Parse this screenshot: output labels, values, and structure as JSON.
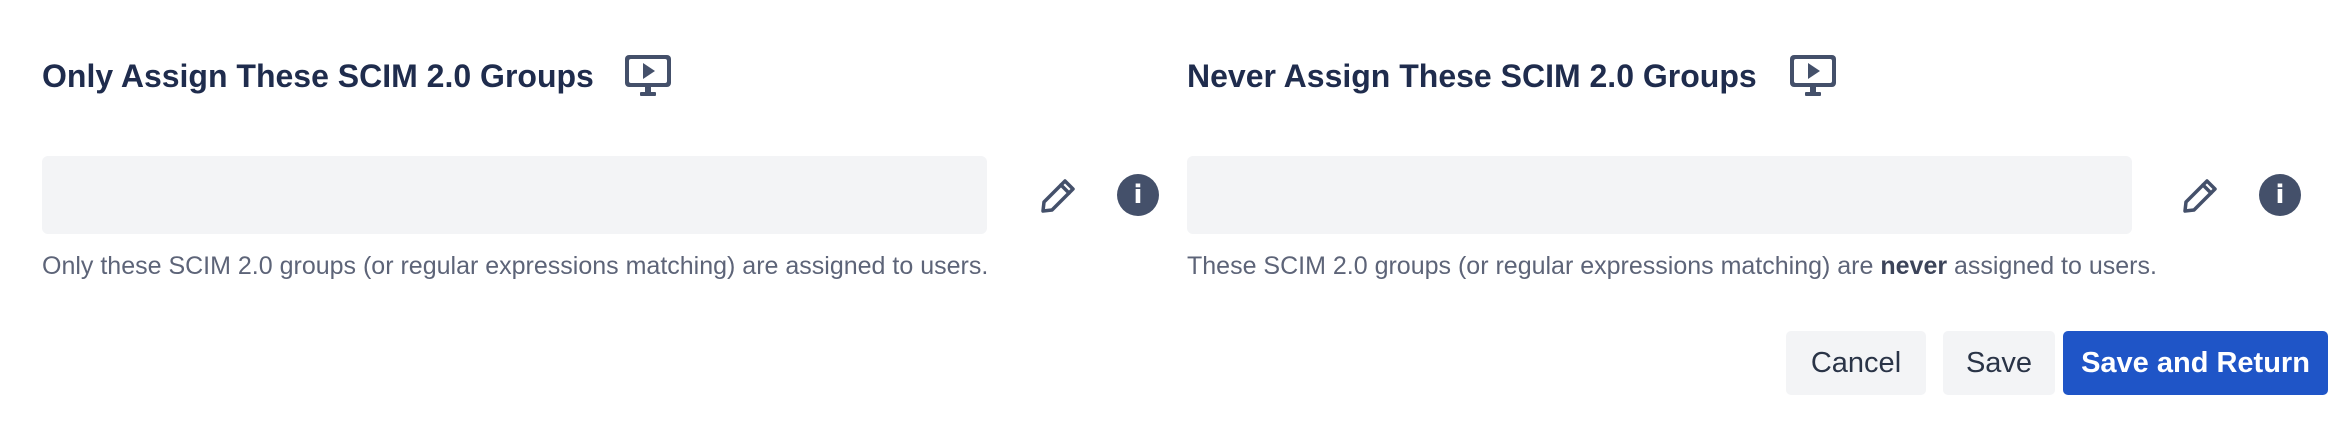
{
  "only_assign": {
    "title": "Only Assign These SCIM 2.0 Groups",
    "field_value": "",
    "help_text": "Only these SCIM 2.0 groups (or regular expressions matching) are assigned to users.",
    "video_icon": "video-play-monitor-icon",
    "edit_icon": "pencil-icon",
    "info_icon": "info-icon",
    "info_glyph": "i"
  },
  "never_assign": {
    "title": "Never Assign These SCIM 2.0 Groups",
    "field_value": "",
    "help_prefix": "These SCIM 2.0 groups (or regular expressions matching) are ",
    "help_emphasis": "never",
    "help_suffix": " assigned to users.",
    "video_icon": "video-play-monitor-icon",
    "edit_icon": "pencil-icon",
    "info_icon": "info-icon",
    "info_glyph": "i"
  },
  "actions": {
    "cancel_label": "Cancel",
    "save_label": "Save",
    "save_and_return_label": "Save and Return"
  },
  "colors": {
    "primary": "#1f55c7",
    "icon": "#44506a",
    "field_bg": "#f3f4f6",
    "title": "#1f2c4d",
    "help_text": "#5d6478"
  }
}
